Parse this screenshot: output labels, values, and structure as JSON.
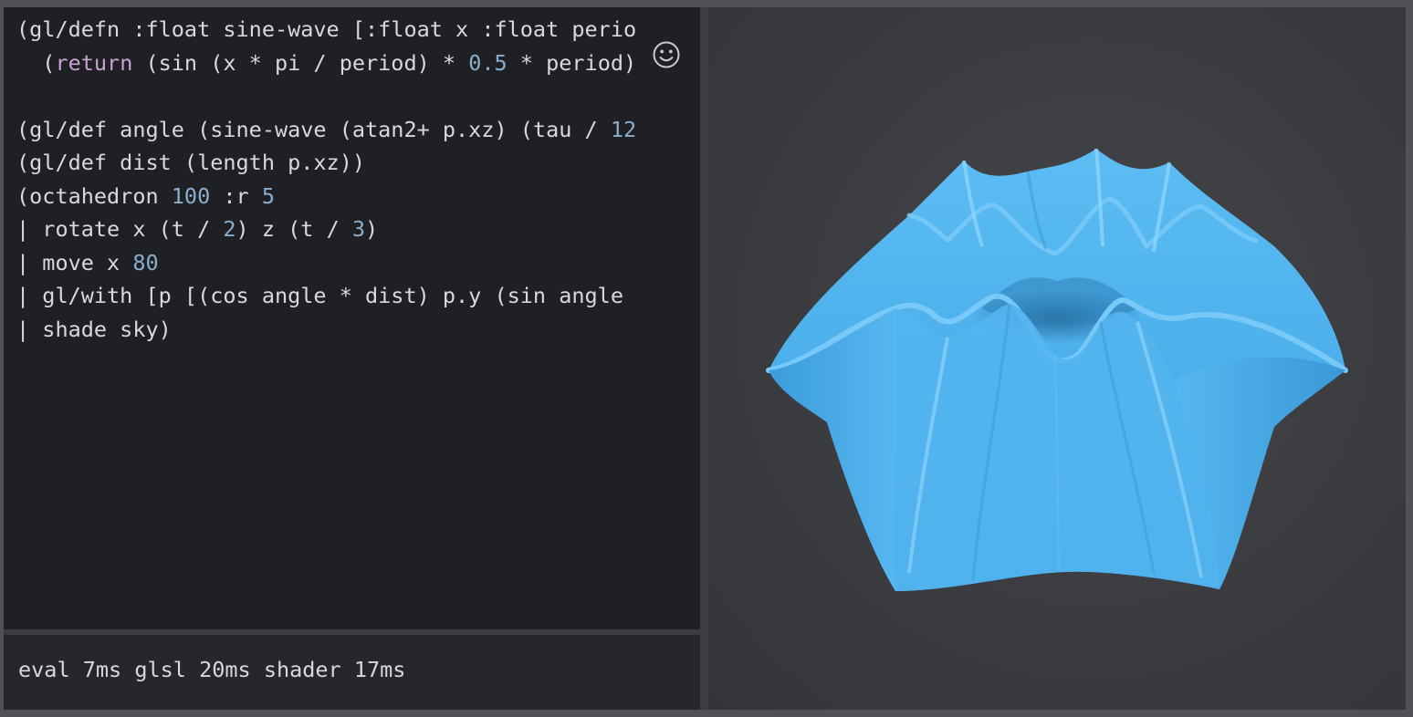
{
  "editor": {
    "lines": [
      [
        {
          "t": "(gl/defn :float sine-wave [:float x :float perio"
        }
      ],
      [
        {
          "t": "  ("
        },
        {
          "t": "return",
          "c": "kw"
        },
        {
          "t": " (sin (x * pi / period) * "
        },
        {
          "t": "0.5",
          "c": "num"
        },
        {
          "t": " * period)"
        }
      ],
      [
        {
          "t": ""
        }
      ],
      [
        {
          "t": "(gl/def angle (sine-wave (atan2+ p.xz) (tau / "
        },
        {
          "t": "12",
          "c": "num"
        }
      ],
      [
        {
          "t": "(gl/def dist (length p.xz))"
        }
      ],
      [
        {
          "t": "(octahedron "
        },
        {
          "t": "100",
          "c": "num"
        },
        {
          "t": " :r "
        },
        {
          "t": "5",
          "c": "num"
        }
      ],
      [
        {
          "t": "| rotate x (t / "
        },
        {
          "t": "2",
          "c": "num"
        },
        {
          "t": ") z (t / "
        },
        {
          "t": "3",
          "c": "num"
        },
        {
          "t": ")"
        }
      ],
      [
        {
          "t": "| move x "
        },
        {
          "t": "80",
          "c": "num"
        }
      ],
      [
        {
          "t": "| gl/with [p [(cos angle * dist) p.y (sin angle "
        }
      ],
      [
        {
          "t": "| shade sky)"
        }
      ]
    ]
  },
  "status": {
    "text": "eval 7ms glsl 20ms shader 17ms"
  },
  "icons": {
    "cursor_overlay": "smiley-icon"
  },
  "viewport": {
    "shape_color": "#4fb1ec",
    "shading": "sky"
  },
  "colors": {
    "number": "#8aaed0",
    "keyword": "#c7a2d6",
    "text": "#d8d9dc",
    "editor_bg": "#1f2023",
    "viewport_bg": "#3b3c40"
  }
}
